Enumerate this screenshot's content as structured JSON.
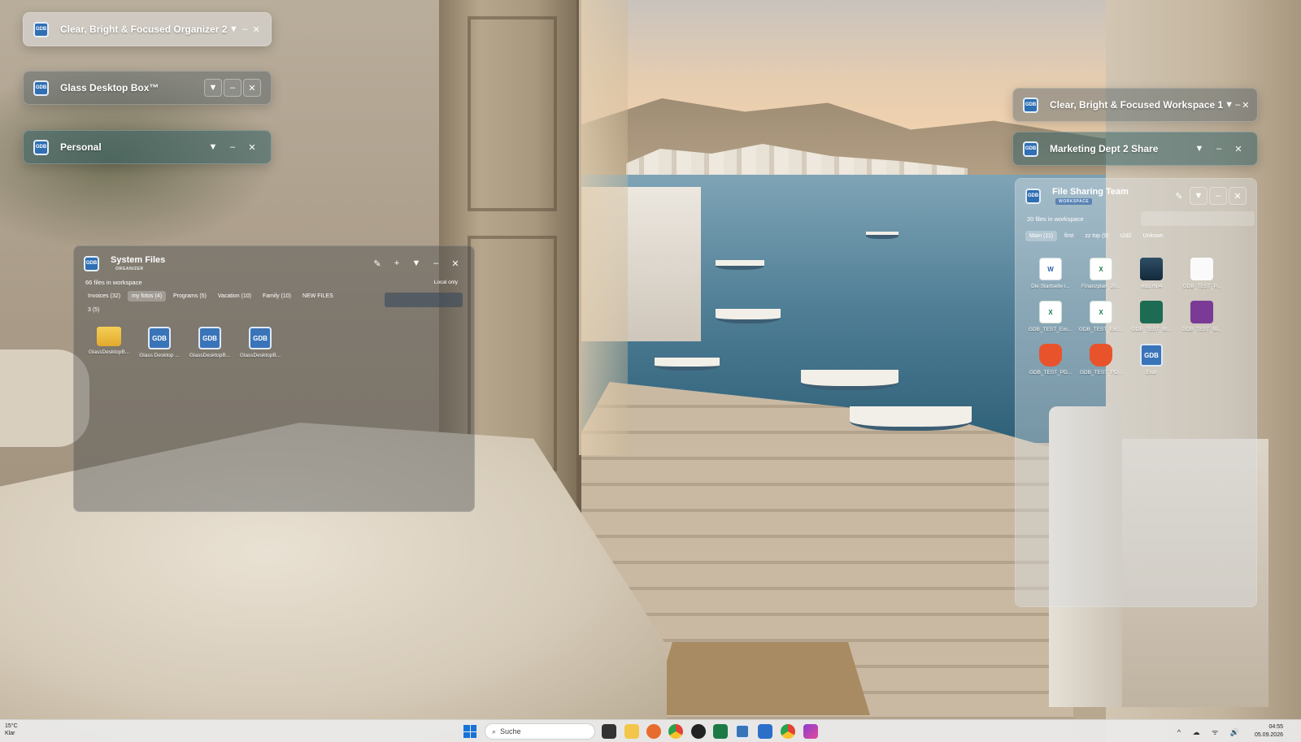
{
  "boxes_collapsed": [
    {
      "title": "Clear, Bright & Focused Organizer 2",
      "style": "light"
    },
    {
      "title": "Glass Desktop Box™",
      "style": "dark"
    },
    {
      "title": "Personal",
      "style": "teal"
    },
    {
      "title": "Clear, Bright & Focused Workspace 1",
      "style": "dark"
    },
    {
      "title": "Marketing Dept 2 Share",
      "style": "teal"
    }
  ],
  "controls": {
    "collapse": "▼",
    "minimize": "–",
    "close": "✕"
  },
  "box_icon_text": "GDB",
  "system_files": {
    "title": "System Files",
    "badge": "ORGANIZER",
    "file_count": "66 files in workspace",
    "local_only": "Local only",
    "controls": {
      "edit": "✎",
      "add": "+"
    },
    "tabs": [
      "Invoices (32)",
      "my fotos (4)",
      "Programs (5)",
      "Vacation (10)",
      "Family (10)",
      "NEW FILES",
      "3 (5)"
    ],
    "active_tab": 1,
    "files": [
      {
        "label": "GlassDesktopB...",
        "icon": "folder-icon"
      },
      {
        "label": "Glass Desktop ...",
        "icon": "gdb-icon",
        "text": "GDB"
      },
      {
        "label": "GlassDesktopB...",
        "icon": "gdb-icon",
        "text": "GDB"
      },
      {
        "label": "GlassDesktopB...",
        "icon": "gdb-icon",
        "text": "GDB"
      }
    ]
  },
  "file_sharing": {
    "title": "File Sharing Team",
    "badge": "WORKSPACE",
    "file_count": "20 files in workspace",
    "tabs": [
      "Main (11)",
      "first",
      "zz top (9)",
      "r2d2",
      "Unkown"
    ],
    "active_tab": 0,
    "files": [
      {
        "label": "Die Startseite i...",
        "icon": "word-icon",
        "text": "W"
      },
      {
        "label": "Finanzplan_26...",
        "icon": "excel-icon",
        "text": "X"
      },
      {
        "label": "vid1.mp4",
        "icon": "image-icon",
        "text": ""
      },
      {
        "label": "GDB_TEST_P...",
        "icon": "white-image-icon",
        "text": ""
      },
      {
        "label": "GDB_TEST_Exc...",
        "icon": "excel-icon",
        "text": "X"
      },
      {
        "label": "GDB_TEST_Exc...",
        "icon": "excel-icon",
        "text": "X"
      },
      {
        "label": "GDB_TEST_Bl...",
        "icon": "green-image-icon",
        "text": ""
      },
      {
        "label": "GDB_TEST_Bl...",
        "icon": "purple-image-icon",
        "text": ""
      },
      {
        "label": "GDB_TEST_PD...",
        "icon": "brave-icon",
        "text": ""
      },
      {
        "label": "GDB_TEST_PD...",
        "icon": "brave-icon",
        "text": ""
      },
      {
        "label": "Exar",
        "icon": "gdb-icon",
        "text": "GDB"
      }
    ]
  },
  "taskbar": {
    "weather_temp": "15°C",
    "weather_desc": "Klar",
    "search_placeholder": "Suche",
    "search_icon": "⌕",
    "tray_icons": "^ ☁ ᯤ 🔊",
    "time": "04:55",
    "date": "05.09.2026"
  }
}
